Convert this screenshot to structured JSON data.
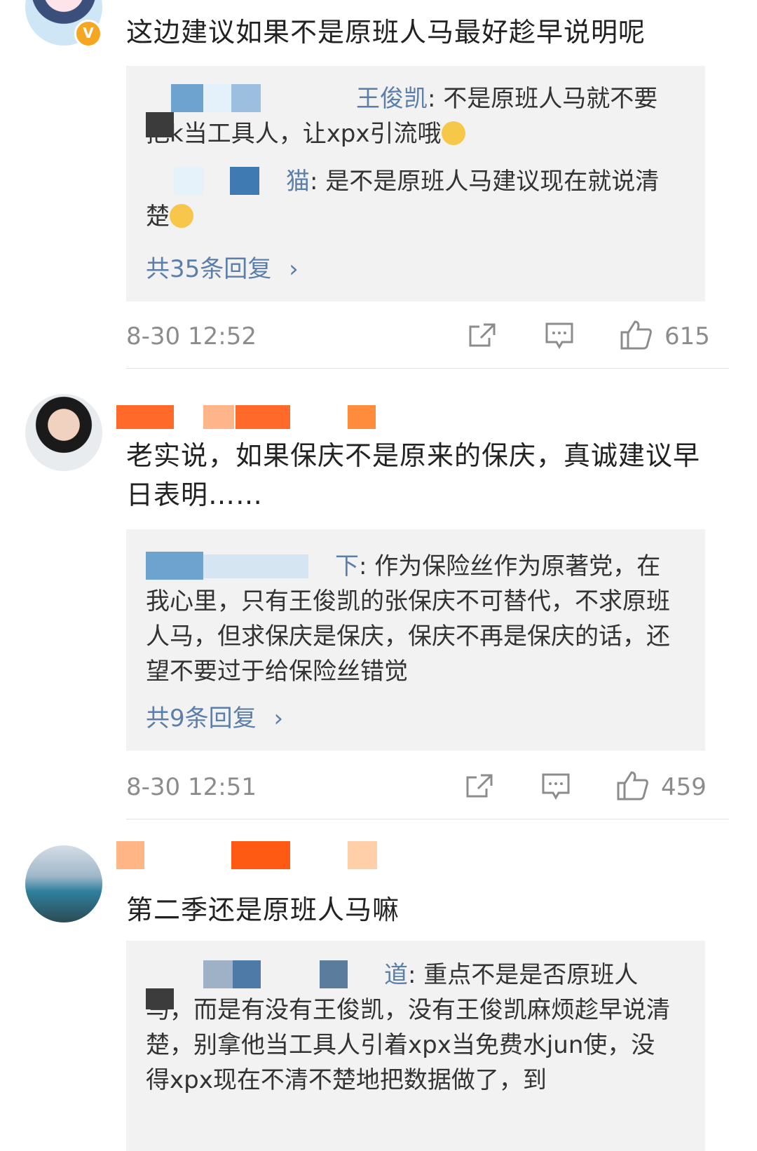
{
  "comments": [
    {
      "text": "这边建议如果不是原班人马最好趁早说明呢",
      "replies": [
        {
          "name_visible": "王俊凯",
          "text": ": 不是原班人马就不要把k当工具人，让xpx引流哦"
        },
        {
          "name_visible": "猫",
          "text": ": 是不是原班人马建议现在就说清楚"
        }
      ],
      "more": "共35条回复",
      "time": "8-30 12:52",
      "likes": "615"
    },
    {
      "text": "老实说，如果保庆不是原来的保庆，真诚建议早日表明……",
      "replies": [
        {
          "name_visible": "下",
          "text": ": 作为保险丝作为原著党，在我心里，只有王俊凯的张保庆不可替代，不求原班人马，但求保庆是保庆，保庆不再是保庆的话，还望不要过于给保险丝错觉"
        }
      ],
      "more": "共9条回复",
      "time": "8-30 12:51",
      "likes": "459"
    },
    {
      "text": "第二季还是原班人马嘛",
      "replies": [
        {
          "name_visible": "道",
          "text": ": 重点不是是否原班人马，而是有没有王俊凯，没有王俊凯麻烦趁早说清楚，别拿他当工具人引着xpx当免费水jun使，没得xpx现在不清不楚地把数据做了，到"
        }
      ]
    }
  ],
  "icons": {
    "share": "share-icon",
    "comment": "comment-icon",
    "like": "thumbs-up-icon",
    "verified": "verified-badge-icon"
  },
  "colors": {
    "link": "#5b7fa8",
    "meta": "#8c8c8c",
    "reply_bg": "#f2f2f2",
    "verified": "#f5a623"
  }
}
